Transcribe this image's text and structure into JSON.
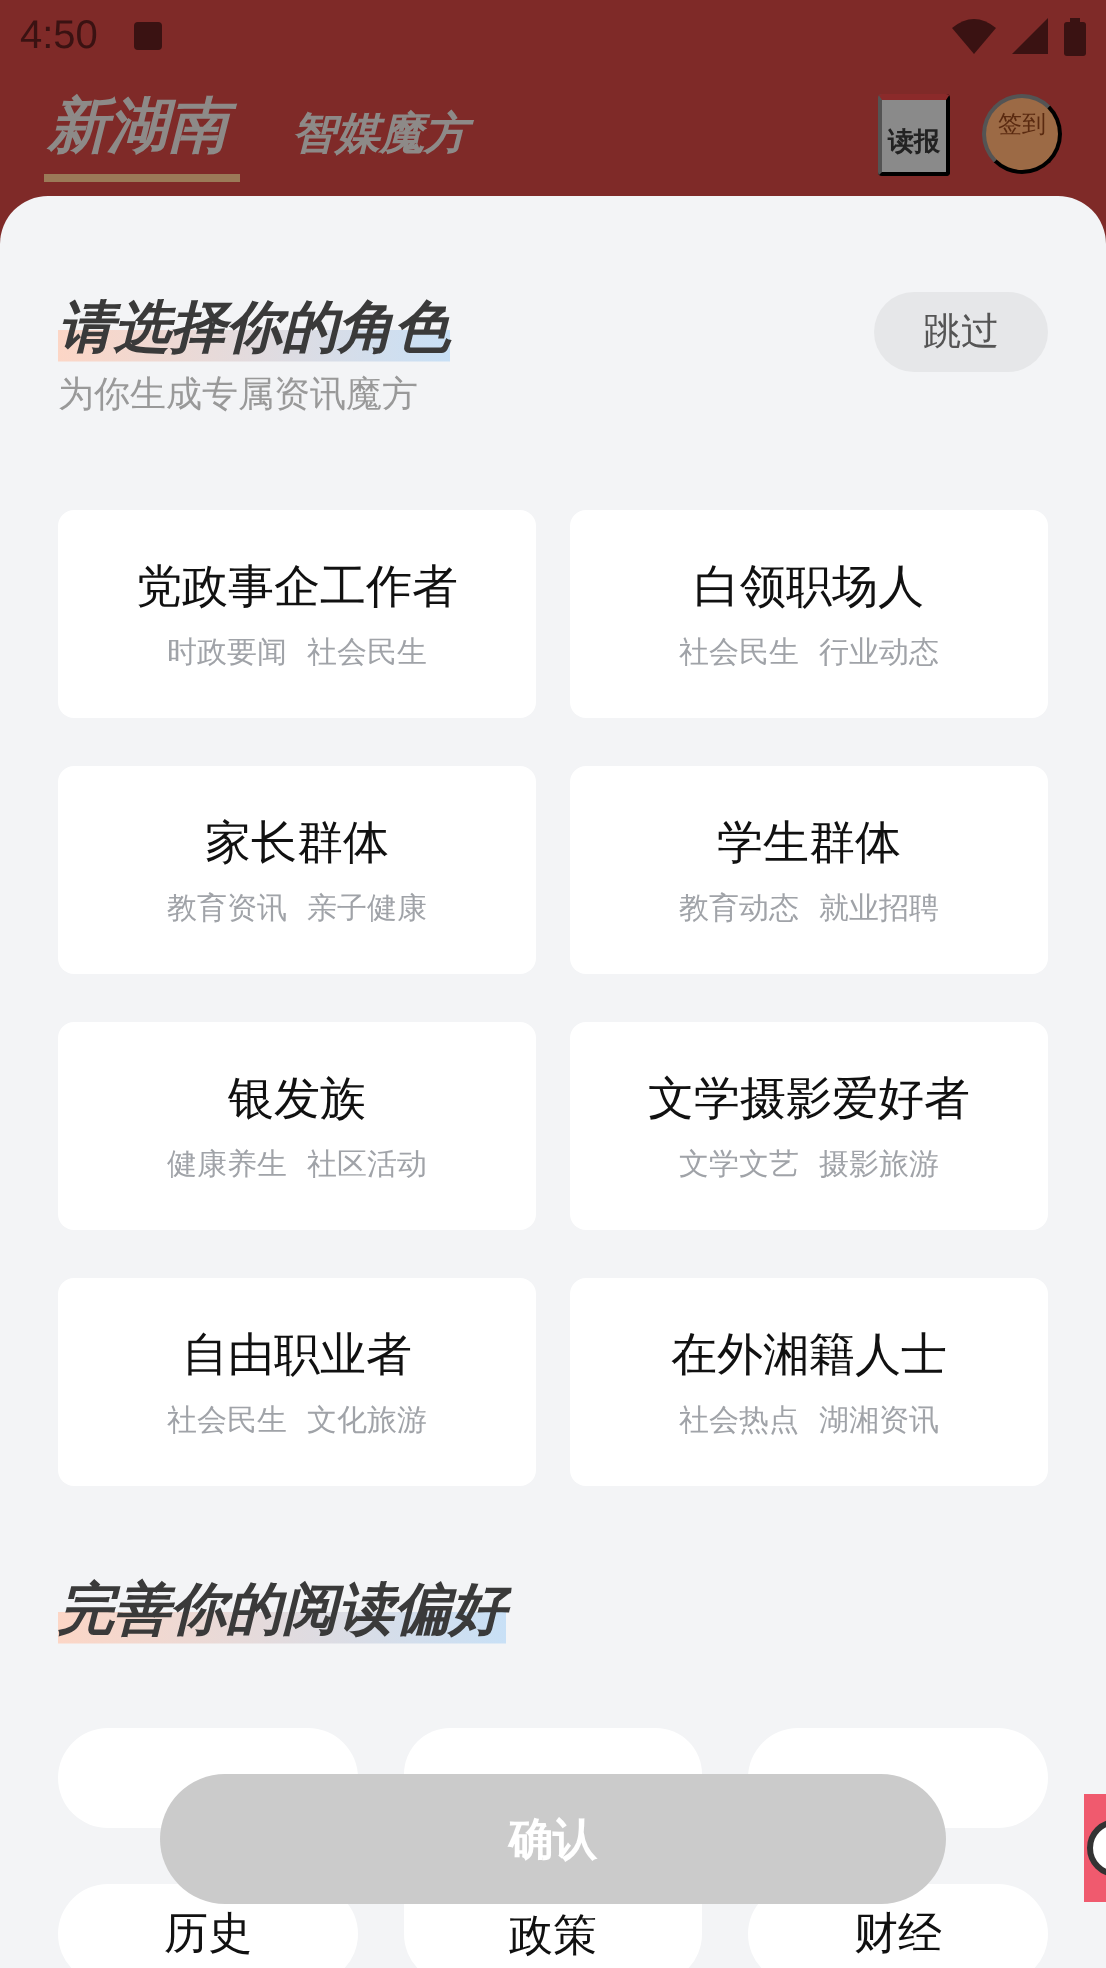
{
  "status_bar": {
    "time": "4:50"
  },
  "header": {
    "logo": "新湖南",
    "title": "智媒魔方",
    "read_paper": "读报",
    "sign_in": "签到"
  },
  "role_section": {
    "title": "请选择你的角色",
    "subtitle": "为你生成专属资讯魔方",
    "skip": "跳过",
    "roles": [
      {
        "name": "党政事企工作者",
        "tags": [
          "时政要闻",
          "社会民生"
        ]
      },
      {
        "name": "白领职场人",
        "tags": [
          "社会民生",
          "行业动态"
        ]
      },
      {
        "name": "家长群体",
        "tags": [
          "教育资讯",
          "亲子健康"
        ]
      },
      {
        "name": "学生群体",
        "tags": [
          "教育动态",
          "就业招聘"
        ]
      },
      {
        "name": "银发族",
        "tags": [
          "健康养生",
          "社区活动"
        ]
      },
      {
        "name": "文学摄影爱好者",
        "tags": [
          "文学文艺",
          "摄影旅游"
        ]
      },
      {
        "name": "自由职业者",
        "tags": [
          "社会民生",
          "文化旅游"
        ]
      },
      {
        "name": "在外湘籍人士",
        "tags": [
          "社会热点",
          "湖湘资讯"
        ]
      }
    ]
  },
  "preference_section": {
    "title": "完善你的阅读偏好",
    "topics": [
      {
        "kind": "covered"
      },
      {
        "kind": "covered"
      },
      {
        "kind": "covered"
      },
      {
        "kind": "label",
        "label": "历史"
      },
      {
        "kind": "label",
        "label": "政策"
      },
      {
        "kind": "label",
        "label": "财经"
      }
    ]
  },
  "confirm": "确认"
}
